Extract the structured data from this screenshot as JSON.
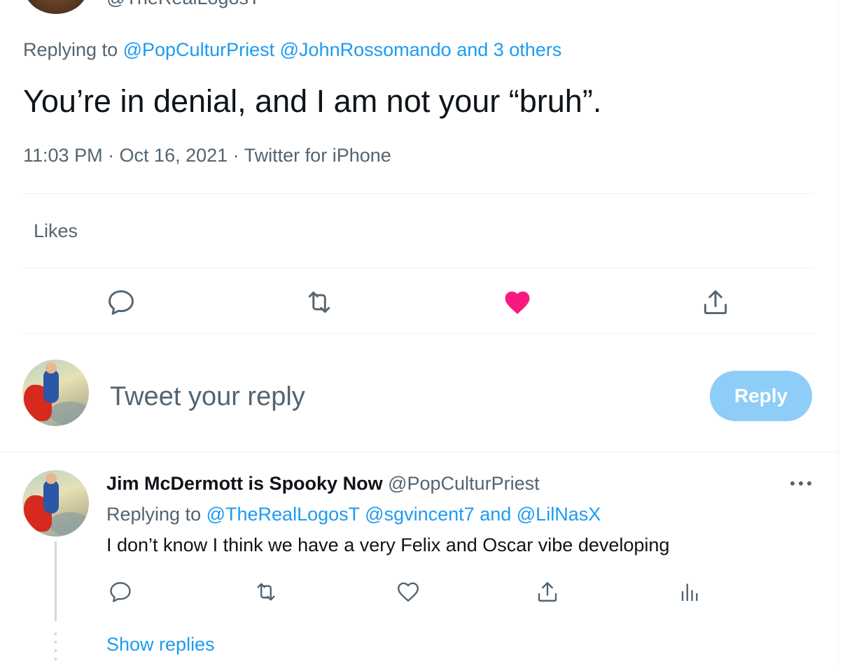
{
  "main_tweet": {
    "author_handle": "@TheRealLogosT",
    "replying_prefix": "Replying to",
    "replying_mentions": [
      "@PopCulturPriest",
      "@JohnRossomando",
      "and 3 others"
    ],
    "text": "You’re in denial, and I am not your “bruh”.",
    "timestamp": "11:03 PM · Oct 16, 2021 · Twitter for iPhone",
    "likes_label": "Likes",
    "actions": {
      "reply_icon": "reply-bubble-icon",
      "retweet_icon": "retweet-icon",
      "like_icon": "heart-filled-icon",
      "share_icon": "share-upload-icon"
    }
  },
  "compose": {
    "placeholder": "Tweet your reply",
    "reply_button": "Reply"
  },
  "reply_tweet": {
    "name": "Jim McDermott is Spooky Now",
    "handle": "@PopCulturPriest",
    "replying_prefix": "Replying to",
    "mention_1": "@TheRealLogosT",
    "mention_2": "@sgvincent7",
    "mention_join": "and",
    "mention_3": "@LilNasX",
    "text": "I don’t know I think we have a very Felix and Oscar vibe developing",
    "more_icon": "more-dots-icon",
    "show_replies": "Show replies"
  },
  "colors": {
    "link": "#1d9bf0",
    "like_active": "#f91880",
    "secondary_text": "#536471",
    "reply_button_disabled": "#8ecdf8"
  }
}
